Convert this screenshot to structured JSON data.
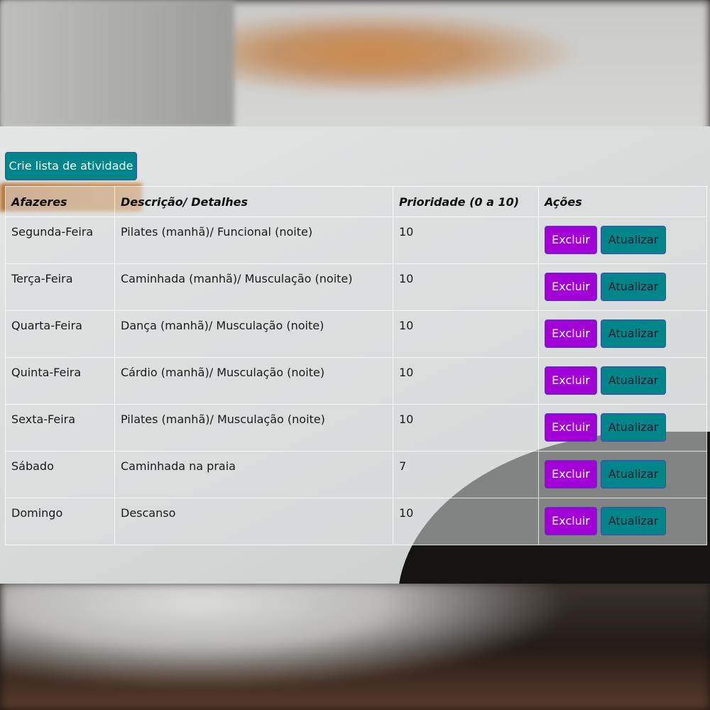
{
  "toolbar": {
    "create_label": "Crie lista de atividade"
  },
  "table": {
    "headers": {
      "task": "Afazeres",
      "description": "Descrição/ Detalhes",
      "priority": "Prioridade (0 a 10)",
      "actions": "Ações"
    },
    "rows": [
      {
        "task": "Segunda-Feira",
        "description": "Pilates (manhã)/ Funcional (noite)",
        "priority": "10"
      },
      {
        "task": "Terça-Feira",
        "description": "Caminhada (manhã)/ Musculação (noite)",
        "priority": "10"
      },
      {
        "task": "Quarta-Feira",
        "description": "Dança (manhã)/ Musculação (noite)",
        "priority": "10"
      },
      {
        "task": "Quinta-Feira",
        "description": "Cárdio (manhã)/ Musculação (noite)",
        "priority": "10"
      },
      {
        "task": "Sexta-Feira",
        "description": "Pilates (manhã)/ Musculação (noite)",
        "priority": "10"
      },
      {
        "task": "Sábado",
        "description": "Caminhada na praia",
        "priority": "7"
      },
      {
        "task": "Domingo",
        "description": "Descanso",
        "priority": "10"
      }
    ],
    "delete_label": "Excluir",
    "update_label": "Atualizar"
  },
  "colors": {
    "create_button": "#00868a",
    "delete_button": "#a300d8",
    "update_button": "#00868a"
  }
}
